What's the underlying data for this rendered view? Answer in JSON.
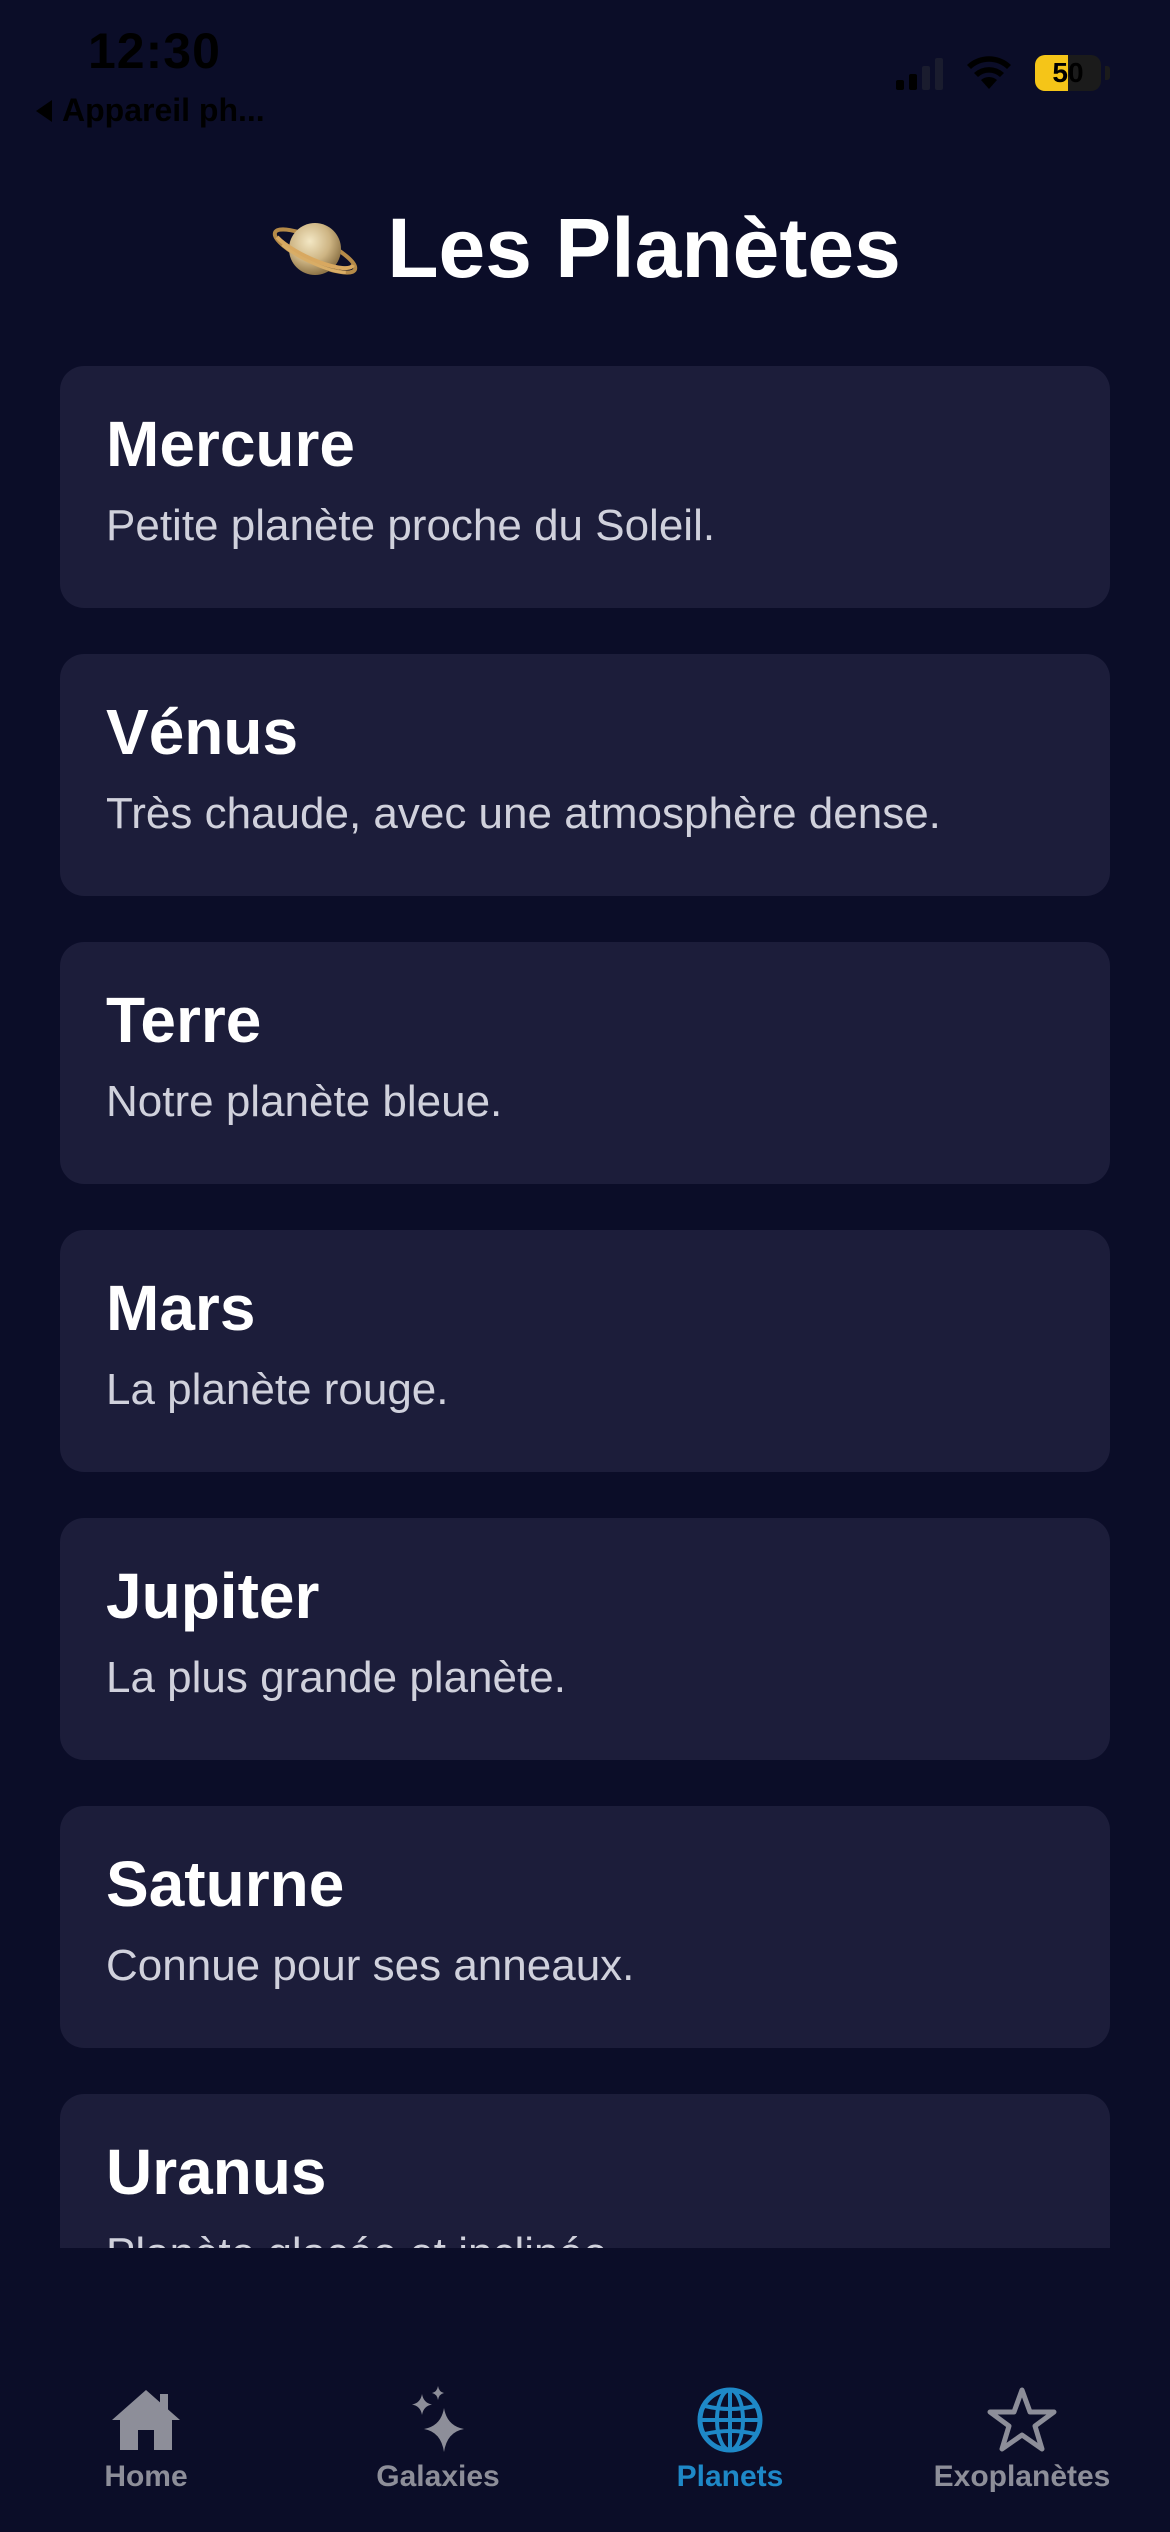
{
  "status_bar": {
    "time": "12:30",
    "back_label": "Appareil ph...",
    "battery_level": "50",
    "battery_fraction": 0.5
  },
  "header": {
    "title": "Les Planètes",
    "icon": "saturn-icon"
  },
  "planets": [
    {
      "name": "Mercure",
      "description": "Petite planète proche du Soleil."
    },
    {
      "name": "Vénus",
      "description": "Très chaude, avec une atmosphère dense."
    },
    {
      "name": "Terre",
      "description": "Notre planète bleue."
    },
    {
      "name": "Mars",
      "description": "La planète rouge."
    },
    {
      "name": "Jupiter",
      "description": "La plus grande planète."
    },
    {
      "name": "Saturne",
      "description": "Connue pour ses anneaux."
    },
    {
      "name": "Uranus",
      "description": "Planète glacée et inclinée."
    }
  ],
  "tabs": [
    {
      "label": "Home",
      "icon": "home-icon",
      "active": false
    },
    {
      "label": "Galaxies",
      "icon": "sparkles-icon",
      "active": false
    },
    {
      "label": "Planets",
      "icon": "globe-icon",
      "active": true
    },
    {
      "label": "Exoplanètes",
      "icon": "star-icon",
      "active": false
    }
  ],
  "colors": {
    "background": "#0b0d28",
    "card": "#1c1d3a",
    "accent": "#1e88c7",
    "inactive_tab": "#8d8e99",
    "battery": "#f5c518"
  }
}
